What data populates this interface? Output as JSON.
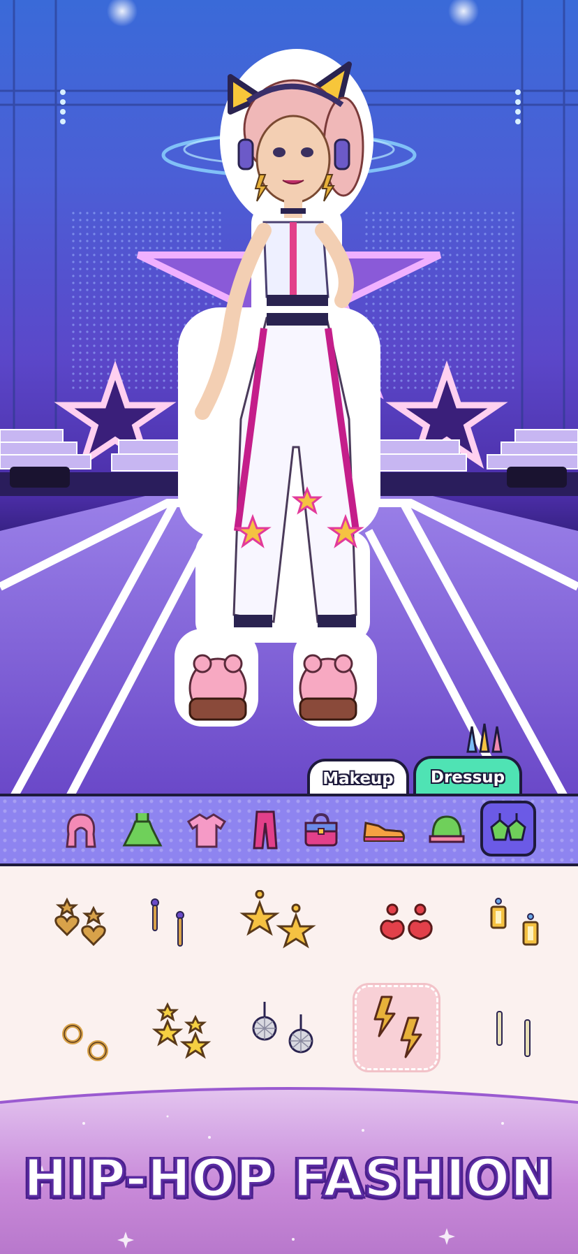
{
  "tabs": {
    "makeup": "Makeup",
    "dressup": "Dressup",
    "active": "Dressup"
  },
  "categories": [
    {
      "name": "hair"
    },
    {
      "name": "dress"
    },
    {
      "name": "top"
    },
    {
      "name": "pants"
    },
    {
      "name": "bag"
    },
    {
      "name": "shoes"
    },
    {
      "name": "hat"
    },
    {
      "name": "earrings",
      "active": true
    }
  ],
  "items": [
    {
      "name": "heart-star-earrings"
    },
    {
      "name": "stick-earrings"
    },
    {
      "name": "starfish-earrings"
    },
    {
      "name": "cherry-earrings"
    },
    {
      "name": "gem-drop-earrings"
    },
    {
      "name": "hoop-earrings"
    },
    {
      "name": "star-dangle-earrings"
    },
    {
      "name": "disco-ball-earrings"
    },
    {
      "name": "lightning-earrings",
      "selected": true
    },
    {
      "name": "bar-earrings"
    }
  ],
  "banner": {
    "title": "HIP-HOP FASHION"
  },
  "colors": {
    "accent_tab": "#4fe3b4",
    "category_bar": "#8e84f0",
    "active_category": "#6b5ae6",
    "title_stroke": "#5b2ca3"
  }
}
